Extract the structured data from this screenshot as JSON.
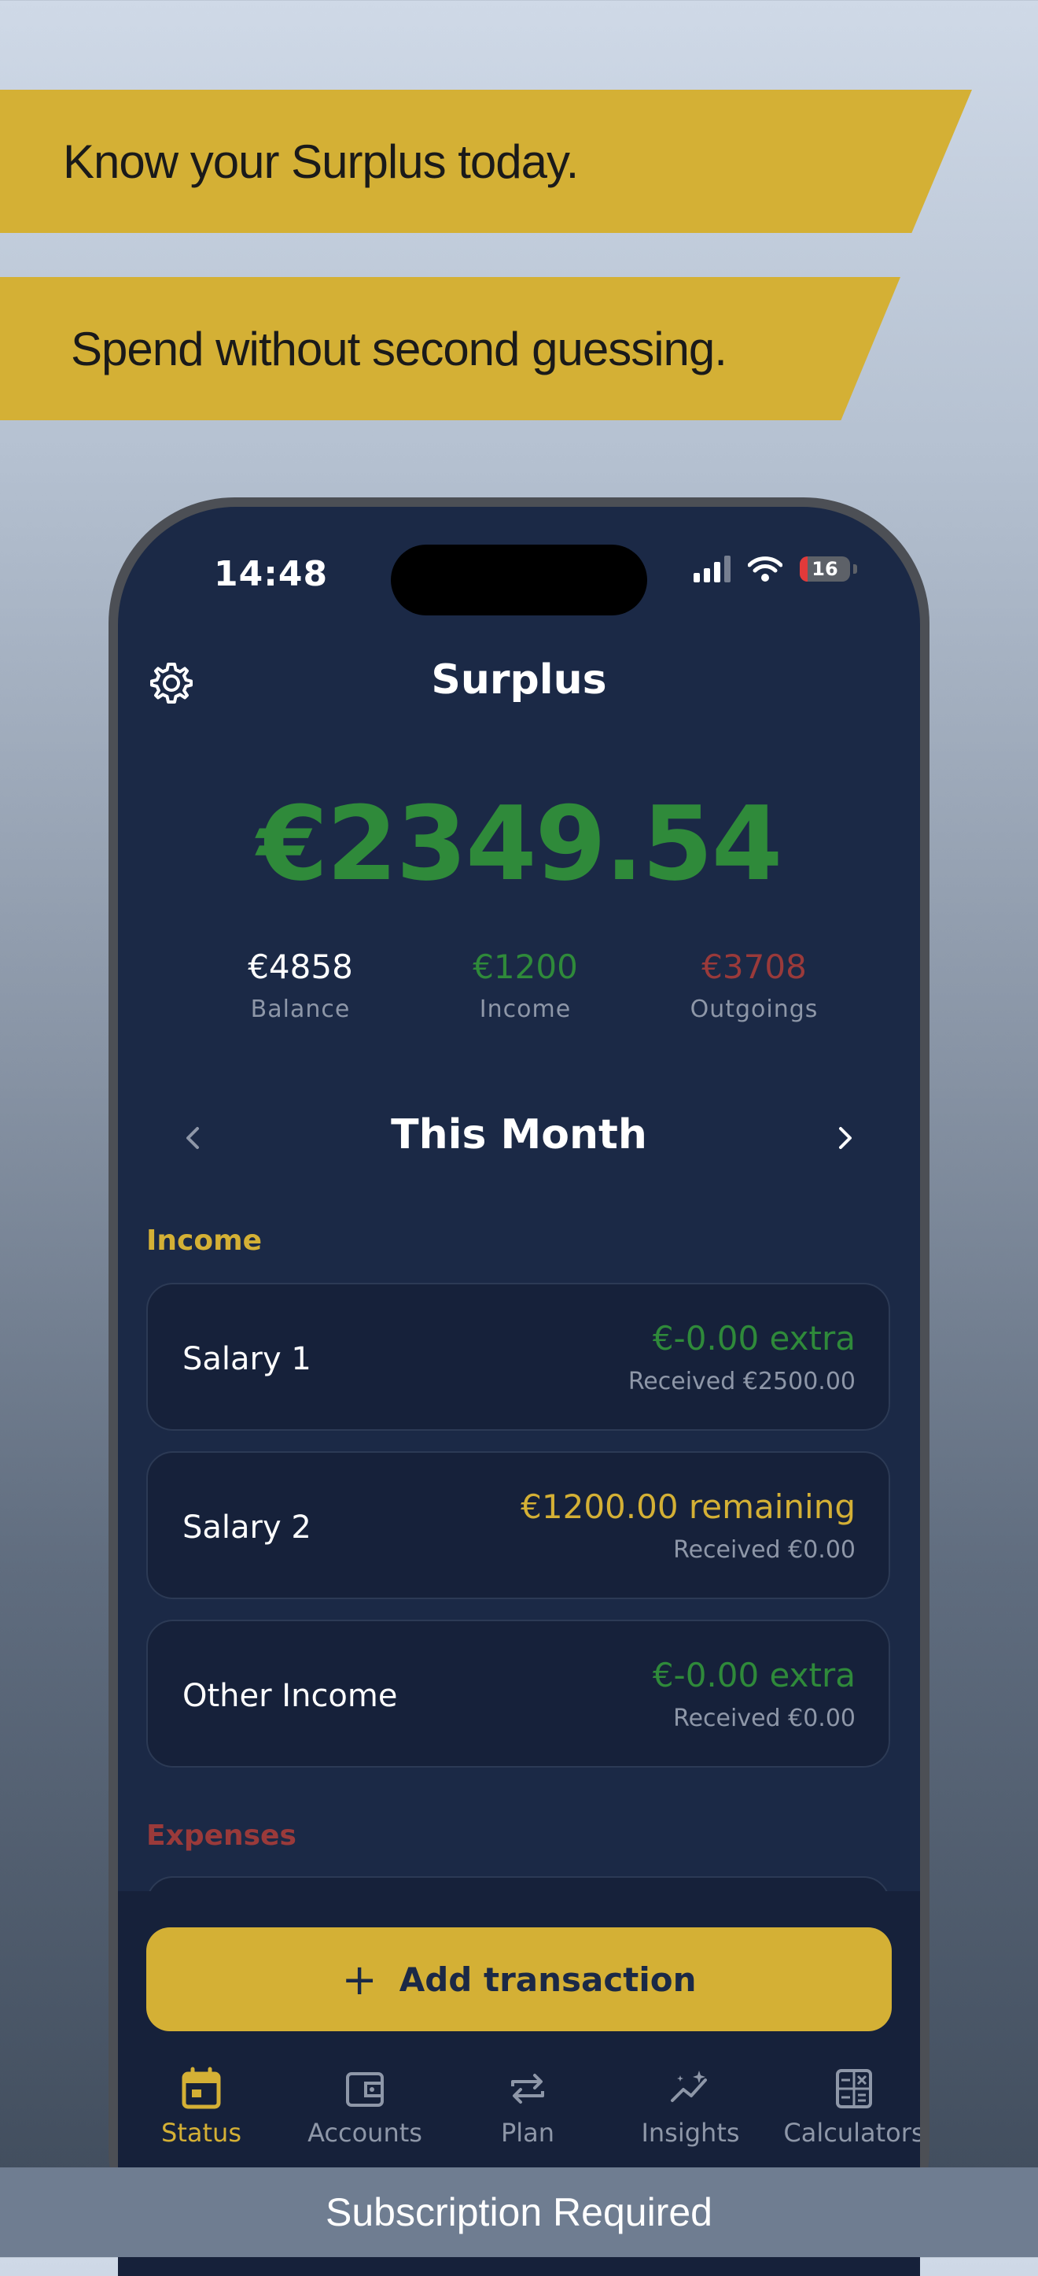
{
  "promo": {
    "line1": "Know your Surplus today.",
    "line2": "Spend without second guessing."
  },
  "status_bar": {
    "time": "14:48",
    "battery": "16"
  },
  "header": {
    "title": "Surplus",
    "settings_icon": "gear-icon"
  },
  "summary": {
    "surplus": "€2349.54",
    "balance_value": "€4858",
    "balance_label": "Balance",
    "income_value": "€1200",
    "income_label": "Income",
    "outgoings_value": "€3708",
    "outgoings_label": "Outgoings"
  },
  "period": {
    "title": "This Month"
  },
  "income": {
    "label": "Income",
    "items": [
      {
        "name": "Salary 1",
        "amount": "€-0.00 extra",
        "received": "Received €2500.00",
        "status": "extra"
      },
      {
        "name": "Salary 2",
        "amount": "€1200.00 remaining",
        "received": "Received €0.00",
        "status": "remaining"
      },
      {
        "name": "Other Income",
        "amount": "€-0.00 extra",
        "received": "Received €0.00",
        "status": "extra"
      }
    ]
  },
  "expenses": {
    "label": "Expenses"
  },
  "actions": {
    "add_transaction": "Add transaction"
  },
  "tabs": [
    {
      "label": "Status",
      "icon": "calendar-icon",
      "active": true
    },
    {
      "label": "Accounts",
      "icon": "wallet-icon",
      "active": false
    },
    {
      "label": "Plan",
      "icon": "repeat-icon",
      "active": false
    },
    {
      "label": "Insights",
      "icon": "sparkline-icon",
      "active": false
    },
    {
      "label": "Calculators",
      "icon": "calculator-icon",
      "active": false
    }
  ],
  "footer": {
    "subscription": "Subscription Required"
  },
  "colors": {
    "accent": "#d4b035",
    "positive": "#2f8a3a",
    "negative": "#9a3a3a",
    "background": "#1b2946"
  }
}
